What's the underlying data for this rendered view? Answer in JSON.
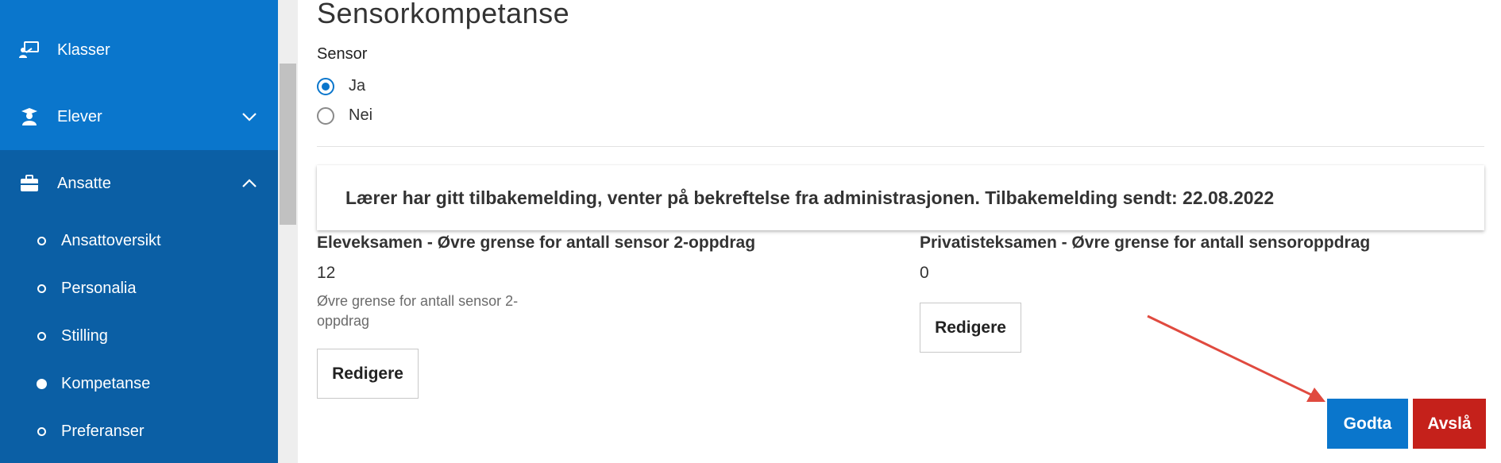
{
  "sidebar": {
    "items": [
      {
        "label": "Klasser",
        "icon": "presentation-board-icon"
      },
      {
        "label": "Elever",
        "icon": "student-icon"
      },
      {
        "label": "Ansatte",
        "icon": "briefcase-icon"
      }
    ],
    "sub_items": [
      {
        "label": "Ansattoversikt",
        "active": false
      },
      {
        "label": "Personalia",
        "active": false
      },
      {
        "label": "Stilling",
        "active": false
      },
      {
        "label": "Kompetanse",
        "active": true
      },
      {
        "label": "Preferanser",
        "active": false
      }
    ]
  },
  "page": {
    "title": "Sensorkompetanse",
    "sensor_label": "Sensor",
    "options": [
      {
        "label": "Ja",
        "checked": true
      },
      {
        "label": "Nei",
        "checked": false
      }
    ],
    "notice": "Lærer har gitt tilbakemelding, venter på bekreftelse fra administrasjonen. Tilbakemelding sendt: 22.08.2022",
    "left_col": {
      "title": "Eleveksamen - Øvre grense for antall sensor 2-oppdrag",
      "value": "12",
      "help": "Øvre grense for antall sensor 2-oppdrag",
      "button": "Redigere"
    },
    "right_col": {
      "title": "Privatisteksamen - Øvre grense for antall sensoroppdrag",
      "value": "0",
      "button": "Redigere"
    },
    "approve_button": "Godta",
    "reject_button": "Avslå"
  },
  "colors": {
    "sidebar_top": "#0a76cc",
    "sidebar_bottom": "#0b5fa5",
    "approve": "#0a76cc",
    "reject": "#c5211b",
    "annotation_arrow": "#e04a3f"
  }
}
